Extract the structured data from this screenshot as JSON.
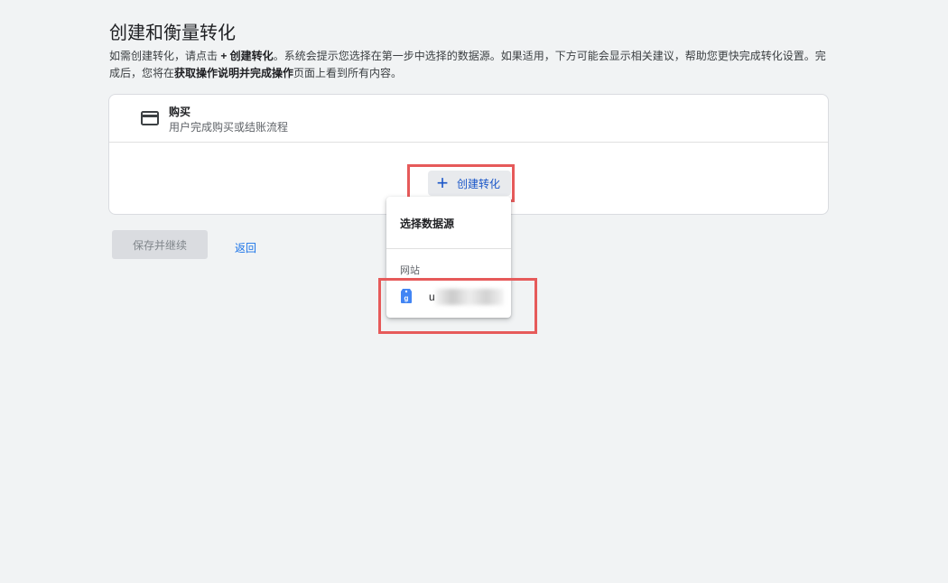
{
  "header": {
    "title": "创建和衡量转化",
    "description_part1": "如需创建转化，请点击 ",
    "description_bold1": "+ 创建转化",
    "description_part2": "。系统会提示您选择在第一步中选择的数据源。如果适用，下方可能会显示相关建议，帮助您更快完成转化设置。完成后，您将在",
    "description_bold2": "获取操作说明并完成操作",
    "description_part3": "页面上看到所有内容。"
  },
  "card": {
    "icon": "credit-card-icon",
    "title": "购买",
    "subtitle": "用户完成购买或结账流程",
    "create_button_label": "创建转化"
  },
  "dropdown": {
    "heading": "选择数据源",
    "section_label": "网站",
    "item_icon": "tag-icon",
    "item_label": "u"
  },
  "actions": {
    "save_label": "保存并继续",
    "back_label": "返回"
  },
  "colors": {
    "accent": "#1a73e8",
    "highlight": "#e65a5a",
    "background": "#f1f3f4"
  }
}
